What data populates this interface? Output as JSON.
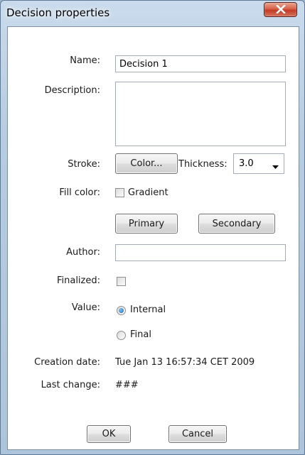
{
  "window": {
    "title": "Decision properties",
    "close_glyph": "✕"
  },
  "form": {
    "name_label": "Name:",
    "name_value": "Decision 1",
    "description_label": "Description:",
    "description_value": "",
    "stroke_label": "Stroke:",
    "color_button": "Color...",
    "thickness_label": "Thickness:",
    "thickness_value": "3.0",
    "fill_label": "Fill color:",
    "gradient_label": "Gradient",
    "gradient_checked": false,
    "primary_button": "Primary",
    "secondary_button": "Secondary",
    "author_label": "Author:",
    "author_value": "",
    "finalized_label": "Finalized:",
    "finalized_checked": false,
    "value_label": "Value:",
    "value_options": [
      "Internal",
      "Final"
    ],
    "value_selected": "Internal",
    "creation_label": "Creation date:",
    "creation_value": "Tue Jan 13 16:57:34 CET 2009",
    "lastchange_label": "Last change:",
    "lastchange_value": "###"
  },
  "footer": {
    "ok_button": "OK",
    "cancel_button": "Cancel"
  }
}
